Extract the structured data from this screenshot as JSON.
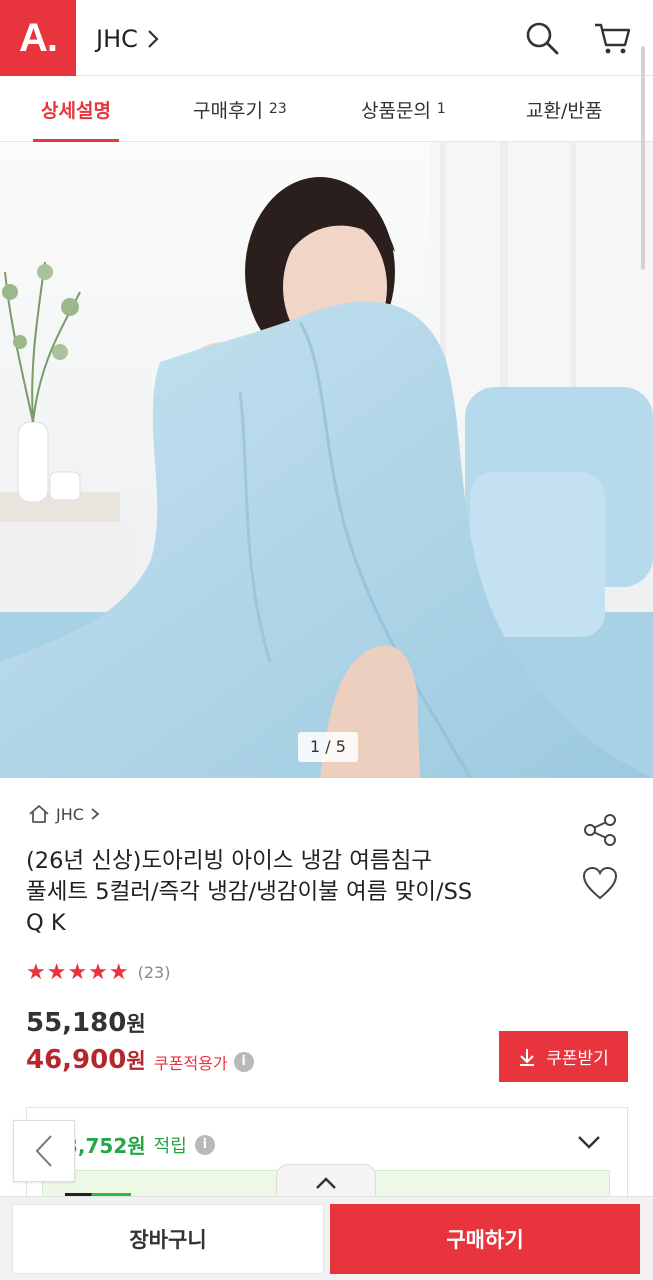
{
  "header": {
    "logo_text": "A.",
    "brand": "JHC",
    "accent_color": "#e8343d",
    "icons": [
      "chevron-right-icon",
      "search-icon",
      "cart-icon"
    ]
  },
  "tabs": [
    {
      "label": "상세설명",
      "count": "",
      "active": true
    },
    {
      "label": "구매후기",
      "count": "23",
      "active": false
    },
    {
      "label": "상품문의",
      "count": "1",
      "active": false
    },
    {
      "label": "교환/반품",
      "count": "",
      "active": false
    }
  ],
  "gallery": {
    "indicator": "1 / 5",
    "current": 1,
    "total": 5
  },
  "product": {
    "store": "JHC",
    "title_lines": [
      "(26년 신상)도아리빙 아이스 냉감 여름침구",
      "풀세트 5컬러/즉각 냉감/냉감이불 여름 맞이/SS",
      "Q K"
    ],
    "rating": 5,
    "rating_stars": "★★★★★",
    "review_count": "(23)",
    "price_original": "55,180",
    "price_sale": "46,900",
    "currency": "원",
    "coupon_note": "쿠폰적용가",
    "coupon_button": "쿠폰받기",
    "points_value": "3,752원",
    "points_label": "적립"
  },
  "bottom": {
    "cart_label": "장바구니",
    "buy_label": "구매하기"
  }
}
